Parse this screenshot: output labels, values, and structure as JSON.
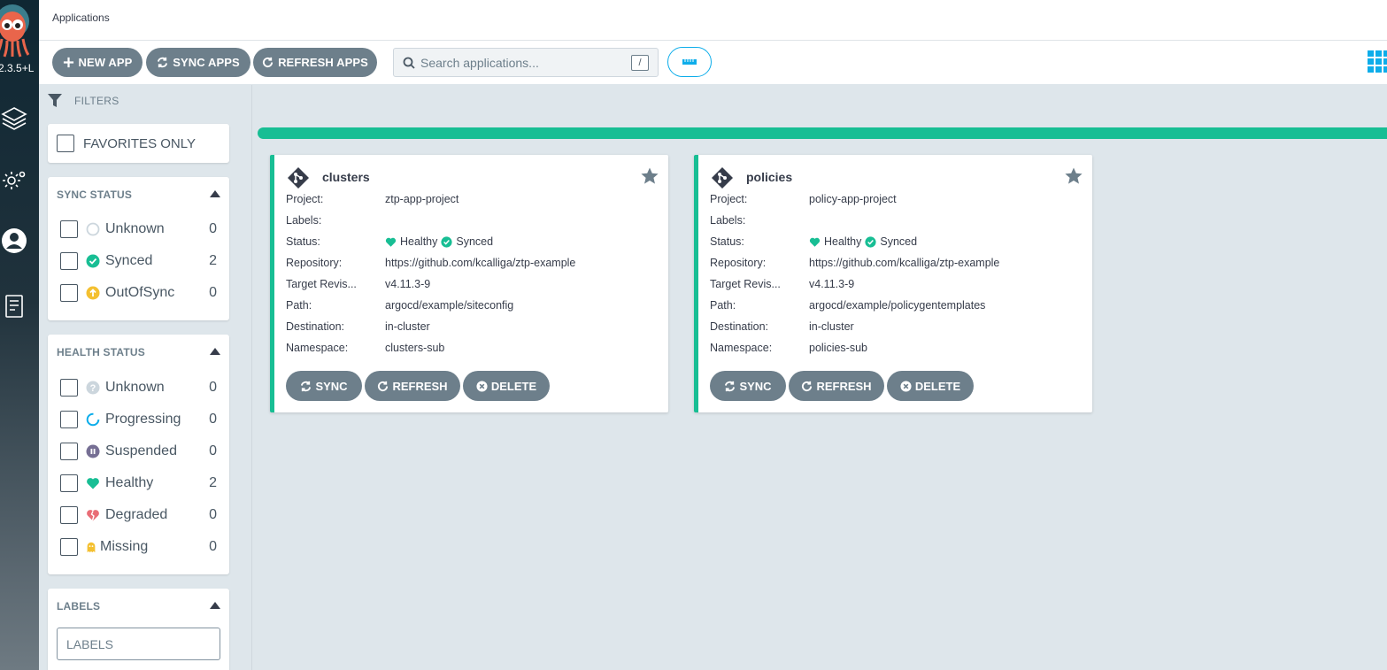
{
  "app": {
    "version": "2.3.5+L",
    "page_title": "Applications"
  },
  "toolbar": {
    "new_app_label": "NEW APP",
    "sync_apps_label": "SYNC APPS",
    "refresh_apps_label": "REFRESH APPS",
    "search_placeholder": "Search applications...",
    "search_shortcut": "/"
  },
  "filters": {
    "header": "FILTERS",
    "favorites_label": "FAVORITES ONLY",
    "sync_status": {
      "title": "SYNC STATUS",
      "items": [
        {
          "label": "Unknown",
          "count": "0",
          "icon": "sync-unknown-icon"
        },
        {
          "label": "Synced",
          "count": "2",
          "icon": "synced-icon"
        },
        {
          "label": "OutOfSync",
          "count": "0",
          "icon": "out-of-sync-icon"
        }
      ]
    },
    "health_status": {
      "title": "HEALTH STATUS",
      "items": [
        {
          "label": "Unknown",
          "count": "0",
          "icon": "health-unknown-icon"
        },
        {
          "label": "Progressing",
          "count": "0",
          "icon": "progressing-icon"
        },
        {
          "label": "Suspended",
          "count": "0",
          "icon": "suspended-icon"
        },
        {
          "label": "Healthy",
          "count": "2",
          "icon": "healthy-heart-icon"
        },
        {
          "label": "Degraded",
          "count": "0",
          "icon": "degraded-broken-heart-icon"
        },
        {
          "label": "Missing",
          "count": "0",
          "icon": "missing-ghost-icon"
        }
      ]
    },
    "labels": {
      "title": "LABELS",
      "placeholder": "LABELS"
    }
  },
  "cards": [
    {
      "name": "clusters",
      "fields": {
        "project_key": "Project:",
        "project": "ztp-app-project",
        "labels_key": "Labels:",
        "labels": "",
        "status_key": "Status:",
        "health": "Healthy",
        "sync": "Synced",
        "repo_key": "Repository:",
        "repository": "https://github.com/kcalliga/ztp-example",
        "rev_key": "Target Revis...",
        "target_revision": "v4.11.3-9",
        "path_key": "Path:",
        "path": "argocd/example/siteconfig",
        "dest_key": "Destination:",
        "destination": "in-cluster",
        "ns_key": "Namespace:",
        "namespace": "clusters-sub"
      },
      "actions": {
        "sync": "SYNC",
        "refresh": "REFRESH",
        "delete": "DELETE"
      }
    },
    {
      "name": "policies",
      "fields": {
        "project_key": "Project:",
        "project": "policy-app-project",
        "labels_key": "Labels:",
        "labels": "",
        "status_key": "Status:",
        "health": "Healthy",
        "sync": "Synced",
        "repo_key": "Repository:",
        "repository": "https://github.com/kcalliga/ztp-example",
        "rev_key": "Target Revis...",
        "target_revision": "v4.11.3-9",
        "path_key": "Path:",
        "path": "argocd/example/policygentemplates",
        "dest_key": "Destination:",
        "destination": "in-cluster",
        "ns_key": "Namespace:",
        "namespace": "policies-sub"
      },
      "actions": {
        "sync": "SYNC",
        "refresh": "REFRESH",
        "delete": "DELETE"
      }
    }
  ],
  "colors": {
    "healthy": "#18be94",
    "synced": "#18be94",
    "out_of_sync": "#f4c030",
    "progressing": "#0dadea",
    "suspended": "#766f94",
    "degraded": "#e96d76",
    "missing": "#f4c030",
    "button": "#6d7f8b",
    "accent": "#0dadea"
  }
}
